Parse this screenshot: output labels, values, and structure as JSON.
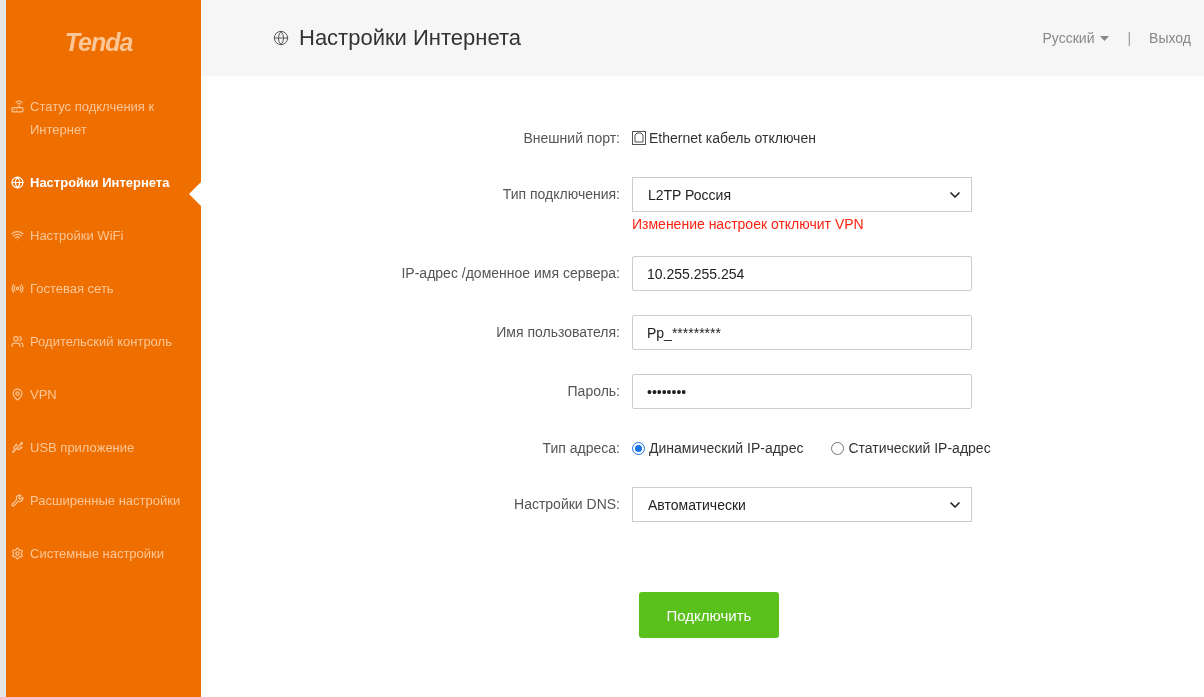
{
  "logo": "Tenda",
  "sidebar": {
    "items": [
      {
        "label": "Статус подклчения к Интернет",
        "selected": false
      },
      {
        "label": "Настройки Интернета",
        "selected": true
      },
      {
        "label": "Настройки WiFi",
        "selected": false
      },
      {
        "label": "Гостевая сеть",
        "selected": false
      },
      {
        "label": "Родительский контроль",
        "selected": false
      },
      {
        "label": "VPN",
        "selected": false
      },
      {
        "label": "USB приложение",
        "selected": false
      },
      {
        "label": "Расширенные настройки",
        "selected": false
      },
      {
        "label": "Системные настройки",
        "selected": false
      }
    ]
  },
  "header": {
    "title": "Настройки Интернета",
    "language": "Русский",
    "separator": "|",
    "logout": "Выход"
  },
  "form": {
    "rows": [
      {
        "kind": "status",
        "label": "Внешний порт:",
        "value": "Ethernet кабель отключен"
      },
      {
        "kind": "select",
        "label": "Тип подключения:",
        "value": "L2TP Россия",
        "warning": "Изменение настроек отключит VPN"
      },
      {
        "kind": "text",
        "label": "IP-адрес /доменное имя сервера:",
        "value": "10.255.255.254"
      },
      {
        "kind": "text",
        "label": "Имя пользователя:",
        "value": "Pp_*********"
      },
      {
        "kind": "text",
        "label": "Пароль:",
        "value": "••••••••"
      },
      {
        "kind": "radio",
        "label": "Тип адреса:",
        "options": [
          {
            "label": "Динамический IP-адрес",
            "selected": true
          },
          {
            "label": "Статический IP-адрес",
            "selected": false
          }
        ]
      },
      {
        "kind": "select",
        "label": "Настройки DNS:",
        "value": "Автоматически"
      }
    ]
  },
  "connect_button": "Подключить"
}
